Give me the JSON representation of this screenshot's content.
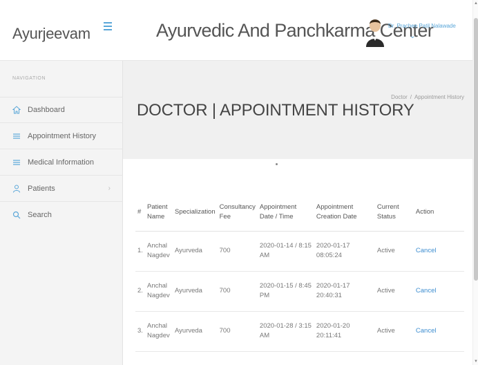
{
  "brand": "Ayurjeevam",
  "app_title": "Ayurvedic And Panchkarma Center",
  "user": {
    "name": "Dr. Prachee Patil Nalawade"
  },
  "nav": {
    "heading": "NAVIGATION",
    "items": [
      {
        "label": "Dashboard",
        "icon": "home-icon"
      },
      {
        "label": "Appointment History",
        "icon": "list-icon"
      },
      {
        "label": "Medical Information",
        "icon": "list-icon"
      },
      {
        "label": "Patients",
        "icon": "user-icon",
        "arrow": "›"
      },
      {
        "label": "Search",
        "icon": "search-icon"
      }
    ]
  },
  "page_title": "DOCTOR | APPOINTMENT HISTORY",
  "breadcrumb": {
    "parent": "Doctor",
    "separator": "/",
    "current": "Appointment History"
  },
  "table": {
    "headers": [
      "#",
      "Patient Name",
      "Specialization",
      "Consultancy Fee",
      "Appointment Date / Time",
      "Appointment Creation Date",
      "Current Status",
      "Action"
    ],
    "rows": [
      {
        "num": "1.",
        "patient": "Anchal Nagdev",
        "specialization": "Ayurveda",
        "fee": "700",
        "appt_date": "2020-01-14 / 8:15 AM",
        "created": "2020-01-17 08:05:24",
        "status": "Active",
        "action": "Cancel"
      },
      {
        "num": "2.",
        "patient": "Anchal Nagdev",
        "specialization": "Ayurveda",
        "fee": "700",
        "appt_date": "2020-01-15 / 8:45 PM",
        "created": "2020-01-17 20:40:31",
        "status": "Active",
        "action": "Cancel"
      },
      {
        "num": "3.",
        "patient": "Anchal Nagdev",
        "specialization": "Ayurveda",
        "fee": "700",
        "appt_date": "2020-01-28 / 3:15 AM",
        "created": "2020-01-20 20:11:41",
        "status": "Active",
        "action": "Cancel"
      }
    ]
  },
  "colors": {
    "accent": "#59a6d8",
    "link": "#3c8dd0",
    "header_bg": "#f0f0f0",
    "sidebar_bg": "#f4f4f4"
  }
}
